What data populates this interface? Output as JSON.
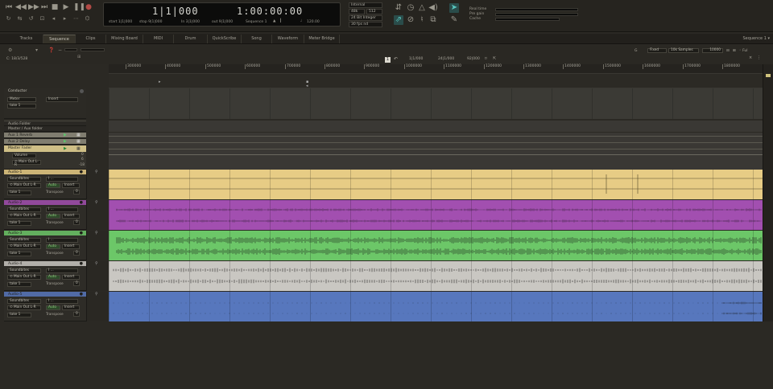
{
  "transport": {
    "counter_main": "1|1|000",
    "counter_secondary": "1:00:00:00",
    "start": "start 1|1|000",
    "stop": "stop 9|1|000",
    "in": "In 3|1|000",
    "out": "out 9|1|000",
    "sequence": "Sequence 1",
    "tempo": "120.00"
  },
  "settings": {
    "sync": "Internal",
    "rate": "48k",
    "buffer": "512",
    "bitdepth": "24 Bit Integer",
    "fps": "30 fps nd"
  },
  "meters": {
    "realtime": "Real time",
    "pregain": "Pre gain",
    "cache": "Cache"
  },
  "tabs": [
    "Tracks",
    "Sequence",
    "Clips",
    "Mixing Board",
    "MIDI",
    "Drum",
    "QuickScribe",
    "Song",
    "Waveform",
    "Meter Bridge"
  ],
  "active_tab": "Sequence",
  "sequence_select": "Sequence 1",
  "toolbar": {
    "location": "C: 18/3/528",
    "nudge_1": "1|1/000",
    "nudge_2": "24|1/000",
    "nudge_3": "92|000",
    "fixed": "Fixed",
    "samples": "10k Samples",
    "zoom": "10000",
    "full": "Ful"
  },
  "ruler": {
    "labels": [
      "300000",
      "400000",
      "500000",
      "600000",
      "700000",
      "800000",
      "900000",
      "1000000",
      "1100000",
      "1200000",
      "1300000",
      "1400000",
      "1500000",
      "1600000",
      "1700000",
      "1800000"
    ]
  },
  "conductor": {
    "name": "Conductor",
    "meter": "Meter",
    "insert": "Insert",
    "take": "take 1"
  },
  "folder": {
    "audio_folder": "Audio Folder",
    "master_aux": "Master / Aux folder",
    "aux1": "Aux 1 Reverb",
    "aux2": "Aux 2 Delay",
    "master": "Master Fader",
    "volume": "Volume",
    "output": "Main Out L-R",
    "db_0": "0",
    "db_6": "6",
    "db_18": "-18"
  },
  "tracks": [
    {
      "name": "Audio-1",
      "color": "#e7cc85",
      "soundbites": "Soundbites",
      "output": "Main Out L-R",
      "auto": "Auto",
      "insert": "Insert",
      "take": "take 1",
      "transpose": "Transpose",
      "transpose_val": "0"
    },
    {
      "name": "Audio-2",
      "color": "#a24fb0",
      "soundbites": "Soundbites",
      "output": "Main Out L-R",
      "auto": "Auto",
      "insert": "Insert",
      "take": "take 1",
      "transpose": "Transpose",
      "transpose_val": "0"
    },
    {
      "name": "Audio-3",
      "color": "#6cc768",
      "soundbites": "Soundbites",
      "output": "Main Out L-R",
      "auto": "Auto",
      "insert": "Insert",
      "take": "take 1",
      "transpose": "Transpose",
      "transpose_val": "0"
    },
    {
      "name": "Audio-4",
      "color": "#c9c7c2",
      "soundbites": "Soundbites",
      "output": "Main Out L-R",
      "auto": "Auto",
      "insert": "Insert",
      "take": "take 1",
      "transpose": "Transpose",
      "transpose_val": "0"
    },
    {
      "name": "Audio-5",
      "color": "#5777bd",
      "soundbites": "Soundbites",
      "output": "Main Out L-R",
      "auto": "Auto",
      "insert": "Insert",
      "take": "take 1",
      "transpose": "Transpose",
      "transpose_val": "0"
    }
  ],
  "colors": {
    "background": "#2b2924",
    "track_yellow": "#e7cc85",
    "track_purple": "#a24fb0",
    "track_green": "#6cc768",
    "track_gray": "#c9c7c2",
    "track_blue": "#5777bd",
    "accent_teal": "#58c6bf"
  }
}
